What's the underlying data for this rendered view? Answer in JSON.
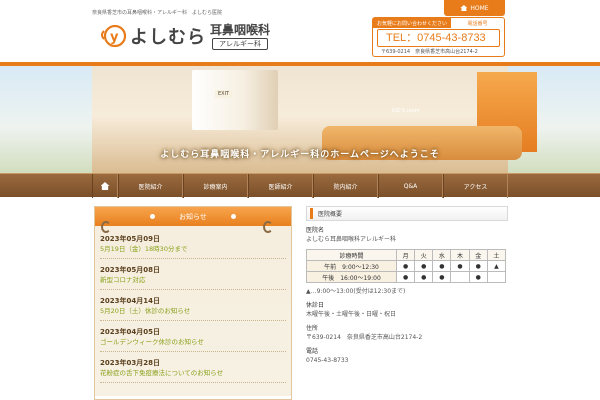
{
  "header": {
    "tagline": "奈良県香芝市の耳鼻咽喉科・アレルギー科　よしむら医院",
    "home_label": "HOME",
    "logo_main": "よしむら",
    "logo_sub1": "耳鼻咽喉科",
    "logo_sub2": "アレルギー科",
    "contact_head1": "お気軽にお問い合わせください",
    "contact_head2": "電話番号",
    "tel": "TEL：0745-43-8733",
    "address": "〒639-0214　奈良県香芝市高山台2174-2"
  },
  "hero": {
    "caption": "よしむら耳鼻咽喉科・アレルギー科のホームページへようこそ",
    "sign_exit": "EXIT",
    "sign_kids": "KID'S room"
  },
  "nav": {
    "items": [
      "医院紹介",
      "診療案内",
      "医師紹介",
      "院内紹介",
      "Q&A",
      "アクセス"
    ]
  },
  "news": {
    "title": "お知らせ",
    "items": [
      {
        "date": "2023年05月09日",
        "title": "5月19日（金）18時30分まで"
      },
      {
        "date": "2023年05月08日",
        "title": "新型コロナ対応"
      },
      {
        "date": "2023年04月14日",
        "title": "5月20日（土）休診のお知らせ"
      },
      {
        "date": "2023年04月05日",
        "title": "ゴールデンウィーク休診のお知らせ"
      },
      {
        "date": "2023年03月28日",
        "title": "花粉症の舌下免疫療法についてのお知らせ"
      }
    ]
  },
  "info": {
    "title": "医院概要",
    "name_label": "医院名",
    "name_value": "よしむら耳鼻咽喉科アレルギー科",
    "table": {
      "head": [
        "診療時間",
        "月",
        "火",
        "水",
        "木",
        "金",
        "土"
      ],
      "rows": [
        {
          "time": "午前　9:00～12:30",
          "marks": [
            "●",
            "●",
            "●",
            "●",
            "●",
            "▲"
          ]
        },
        {
          "time": "午後　16:00～19:00",
          "marks": [
            "●",
            "●",
            "●",
            "",
            "●",
            ""
          ]
        }
      ]
    },
    "note": "▲…9:00～13:00(受付は12:30まで)",
    "holiday_label": "休診日",
    "holiday_value": "木曜午後・土曜午後・日曜・祝日",
    "address_label": "住所",
    "address_value": "〒639-0214　奈良県香芝市高山台2174-2",
    "tel_label": "電話",
    "tel_value": "0745-43-8733"
  }
}
